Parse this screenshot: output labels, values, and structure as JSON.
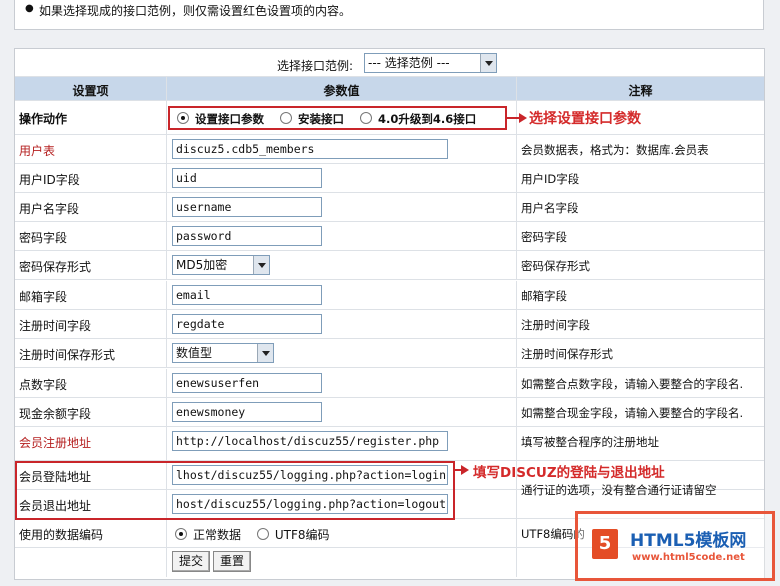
{
  "tip": "如果选择现成的接口范例，则仅需设置红色设置项的内容。",
  "example": {
    "label": "选择接口范例:",
    "value": "--- 选择范例 ---"
  },
  "headers": {
    "setting": "设置项",
    "param": "参数值",
    "note": "注释"
  },
  "action": {
    "label": "操作动作",
    "options": [
      "设置接口参数",
      "安装接口",
      "4.0升级到4.6接口"
    ],
    "callout": "选择设置接口参数"
  },
  "rows": [
    {
      "label": "用户表",
      "value": "discuz5.cdb5_members",
      "note": "会员数据表，格式为：数据库.会员表"
    },
    {
      "label": "用户ID字段",
      "value": "uid",
      "note": "用户ID字段"
    },
    {
      "label": "用户名字段",
      "value": "username",
      "note": "用户名字段"
    },
    {
      "label": "密码字段",
      "value": "password",
      "note": "密码字段"
    },
    {
      "label": "密码保存形式",
      "value": "MD5加密",
      "note": "密码保存形式"
    },
    {
      "label": "邮箱字段",
      "value": "email",
      "note": "邮箱字段"
    },
    {
      "label": "注册时间字段",
      "value": "regdate",
      "note": "注册时间字段"
    },
    {
      "label": "注册时间保存形式",
      "value": "数值型",
      "note": "注册时间保存形式"
    },
    {
      "label": "点数字段",
      "value": "enewsuserfen",
      "note": "如需整合点数字段，请输入要整合的字段名."
    },
    {
      "label": "现金余额字段",
      "value": "enewsmoney",
      "note": "如需整合现金字段，请输入要整合的字段名."
    },
    {
      "label": "会员注册地址",
      "value": "http://localhost/discuz55/register.php",
      "note": "填写被整合程序的注册地址"
    },
    {
      "label": "会员登陆地址",
      "value": "lhost/discuz55/logging.php?action=login",
      "note": ""
    },
    {
      "label": "会员退出地址",
      "value": "host/discuz55/logging.php?action=logout",
      "note": ""
    }
  ],
  "login_note": "通行证的选项，没有整合通行证请留空",
  "login_callout": "填写DISCUZ的登陆与退出地址",
  "encoding": {
    "label": "使用的数据编码",
    "options": [
      "正常数据",
      "UTF8编码"
    ],
    "note": "UTF8编码的"
  },
  "buttons": {
    "submit": "提交",
    "reset": "重置"
  },
  "watermark": {
    "text": "HTML5模板网",
    "url": "www.html5code.net"
  }
}
